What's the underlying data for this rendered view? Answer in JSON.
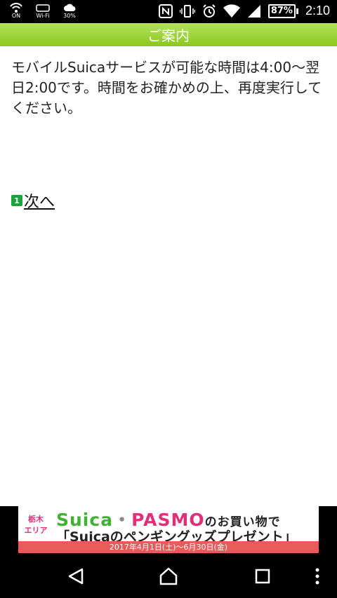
{
  "status_bar": {
    "left_items": [
      {
        "icon": "nfc-on-icon",
        "label": "ON"
      },
      {
        "icon": "wifi-direct-icon",
        "label": "Wi-Fi"
      },
      {
        "icon": "cloud-icon",
        "label": "30%"
      }
    ],
    "right_icons": [
      "nfc-icon",
      "vibrate-icon",
      "alarm-icon",
      "wifi-icon",
      "signal-icon"
    ],
    "battery": "87%",
    "time": "2:10"
  },
  "header": {
    "title": "ご案内"
  },
  "content": {
    "message": "モバイルSuicaサービスが可能な時間は4:00～翌日2:00です。時間をお確かめの上、再度実行してください。",
    "link": {
      "key_number": "1",
      "label": "次へ"
    }
  },
  "ad": {
    "area_line1": "栃木",
    "area_line2": "エリア",
    "suica": "Suica",
    "dot": "・",
    "pasmo": "PASMO",
    "tail": "のお買い物で",
    "line2": "「Suicaのペンギングッズプレゼント」",
    "dates": "2017年4月1日(土)～6月30日(金)"
  },
  "navbar": {
    "buttons": [
      "back",
      "home",
      "recents",
      "more"
    ]
  },
  "colors": {
    "header_green": "#8cc820",
    "link_icon": "#1aa33a",
    "ad_green": "#3fb236",
    "ad_pink": "#e1307a"
  }
}
